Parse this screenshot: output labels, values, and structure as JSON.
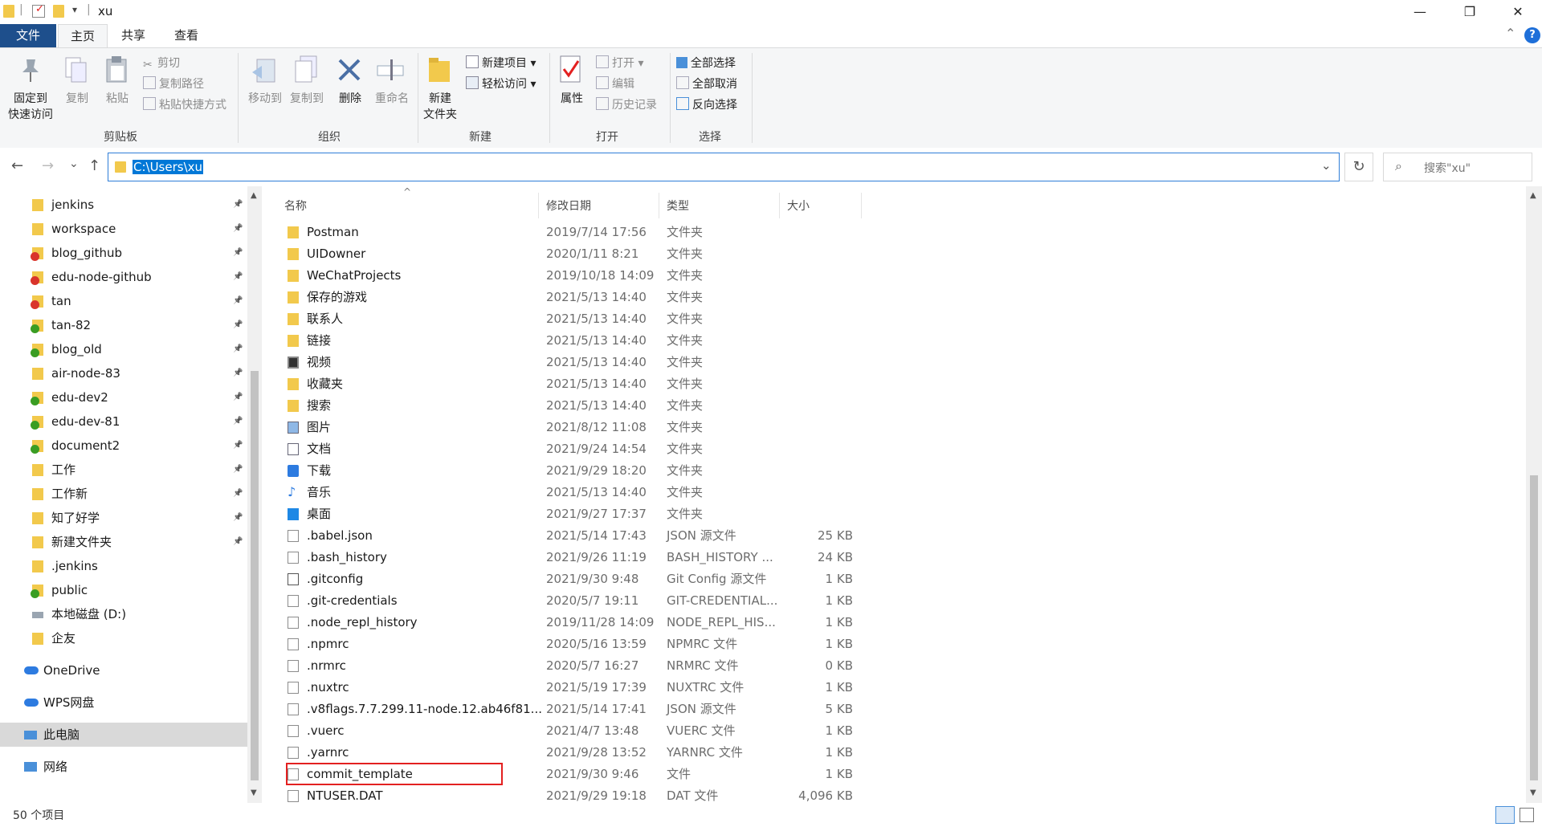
{
  "window": {
    "title": "xu",
    "controls": {
      "minimize": "—",
      "maximize": "❐",
      "close": "✕"
    },
    "quick_access_dropdown": "▾",
    "divider": "|"
  },
  "ribbon_tabs": [
    "文件",
    "主页",
    "共享",
    "查看"
  ],
  "ribbon_right": {
    "collapse": "⌃",
    "help": "?"
  },
  "ribbon": {
    "clipboard": {
      "pin_label_1": "固定到",
      "pin_label_2": "快速访问",
      "copy": "复制",
      "paste": "粘贴",
      "cut": "剪切",
      "copy_path": "复制路径",
      "paste_shortcut": "粘贴快捷方式",
      "group": "剪贴板"
    },
    "organize": {
      "move_to": "移动到",
      "copy_to": "复制到",
      "delete": "删除",
      "rename": "重命名",
      "group": "组织"
    },
    "new": {
      "new_folder_1": "新建",
      "new_folder_2": "文件夹",
      "new_item": "新建项目 ▾",
      "easy_access": "轻松访问 ▾",
      "group": "新建"
    },
    "open": {
      "properties": "属性",
      "open": "打开 ▾",
      "edit": "编辑",
      "history": "历史记录",
      "group": "打开"
    },
    "select": {
      "select_all": "全部选择",
      "select_none": "全部取消",
      "invert": "反向选择",
      "group": "选择"
    }
  },
  "address_bar": {
    "back": "←",
    "forward": "→",
    "recent": "⌄",
    "up": "↑",
    "path": "C:\\Users\\xu",
    "dropdown": "⌄",
    "refresh": "↻",
    "search_placeholder": "搜索\"xu\"",
    "search_icon": "⌕"
  },
  "nav_pane": {
    "quick_access": [
      {
        "label": "jenkins",
        "icon": "folder",
        "pinned": true
      },
      {
        "label": "workspace",
        "icon": "folder",
        "pinned": true
      },
      {
        "label": "blog_github",
        "icon": "git-conflict",
        "pinned": true
      },
      {
        "label": "edu-node-github",
        "icon": "git-conflict",
        "pinned": true
      },
      {
        "label": "tan",
        "icon": "git-conflict",
        "pinned": true
      },
      {
        "label": "tan-82",
        "icon": "git-ok",
        "pinned": true
      },
      {
        "label": "blog_old",
        "icon": "git-ok",
        "pinned": true
      },
      {
        "label": "air-node-83",
        "icon": "folder",
        "pinned": true
      },
      {
        "label": "edu-dev2",
        "icon": "git-ok",
        "pinned": true
      },
      {
        "label": "edu-dev-81",
        "icon": "git-ok",
        "pinned": true
      },
      {
        "label": "document2",
        "icon": "git-ok",
        "pinned": true
      },
      {
        "label": "工作",
        "icon": "folder",
        "pinned": true
      },
      {
        "label": "工作新",
        "icon": "folder",
        "pinned": true
      },
      {
        "label": "知了好学",
        "icon": "folder",
        "pinned": true
      },
      {
        "label": "新建文件夹",
        "icon": "folder",
        "pinned": true
      },
      {
        "label": ".jenkins",
        "icon": "folder",
        "pinned": false
      },
      {
        "label": "public",
        "icon": "git-ok",
        "pinned": false
      },
      {
        "label": "本地磁盘 (D:)",
        "icon": "drive",
        "pinned": false
      },
      {
        "label": "企友",
        "icon": "folder",
        "pinned": false
      }
    ],
    "locations": [
      {
        "label": "OneDrive",
        "icon": "cloud"
      },
      {
        "label": "WPS网盘",
        "icon": "cloud"
      },
      {
        "label": "此电脑",
        "icon": "computer",
        "selected": true
      },
      {
        "label": "网络",
        "icon": "network"
      }
    ]
  },
  "columns": {
    "name": "名称",
    "modified": "修改日期",
    "type": "类型",
    "size": "大小"
  },
  "sort_indicator": "^",
  "files": [
    {
      "name": "Postman",
      "date": "2019/7/14 17:56",
      "type": "文件夹",
      "size": "",
      "icon": "folder"
    },
    {
      "name": "UIDowner",
      "date": "2020/1/11 8:21",
      "type": "文件夹",
      "size": "",
      "icon": "folder"
    },
    {
      "name": "WeChatProjects",
      "date": "2019/10/18 14:09",
      "type": "文件夹",
      "size": "",
      "icon": "folder"
    },
    {
      "name": "保存的游戏",
      "date": "2021/5/13 14:40",
      "type": "文件夹",
      "size": "",
      "icon": "folder"
    },
    {
      "name": "联系人",
      "date": "2021/5/13 14:40",
      "type": "文件夹",
      "size": "",
      "icon": "folder"
    },
    {
      "name": "链接",
      "date": "2021/5/13 14:40",
      "type": "文件夹",
      "size": "",
      "icon": "folder"
    },
    {
      "name": "视频",
      "date": "2021/5/13 14:40",
      "type": "文件夹",
      "size": "",
      "icon": "video"
    },
    {
      "name": "收藏夹",
      "date": "2021/5/13 14:40",
      "type": "文件夹",
      "size": "",
      "icon": "folder"
    },
    {
      "name": "搜索",
      "date": "2021/5/13 14:40",
      "type": "文件夹",
      "size": "",
      "icon": "folder"
    },
    {
      "name": "图片",
      "date": "2021/8/12 11:08",
      "type": "文件夹",
      "size": "",
      "icon": "pictures"
    },
    {
      "name": "文档",
      "date": "2021/9/24 14:54",
      "type": "文件夹",
      "size": "",
      "icon": "documents"
    },
    {
      "name": "下载",
      "date": "2021/9/29 18:20",
      "type": "文件夹",
      "size": "",
      "icon": "download"
    },
    {
      "name": "音乐",
      "date": "2021/5/13 14:40",
      "type": "文件夹",
      "size": "",
      "icon": "music"
    },
    {
      "name": "桌面",
      "date": "2021/9/27 17:37",
      "type": "文件夹",
      "size": "",
      "icon": "desktop"
    },
    {
      "name": ".babel.json",
      "date": "2021/5/14 17:43",
      "type": "JSON 源文件",
      "size": "25 KB",
      "icon": "json"
    },
    {
      "name": ".bash_history",
      "date": "2021/9/26 11:19",
      "type": "BASH_HISTORY ...",
      "size": "24 KB",
      "icon": "file"
    },
    {
      "name": ".gitconfig",
      "date": "2021/9/30 9:48",
      "type": "Git Config 源文件",
      "size": "1 KB",
      "icon": "gear-file"
    },
    {
      "name": ".git-credentials",
      "date": "2020/5/7 19:11",
      "type": "GIT-CREDENTIAL...",
      "size": "1 KB",
      "icon": "file"
    },
    {
      "name": ".node_repl_history",
      "date": "2019/11/28 14:09",
      "type": "NODE_REPL_HIS...",
      "size": "1 KB",
      "icon": "file"
    },
    {
      "name": ".npmrc",
      "date": "2020/5/16 13:59",
      "type": "NPMRC 文件",
      "size": "1 KB",
      "icon": "file"
    },
    {
      "name": ".nrmrc",
      "date": "2020/5/7 16:27",
      "type": "NRMRC 文件",
      "size": "0 KB",
      "icon": "file"
    },
    {
      "name": ".nuxtrc",
      "date": "2021/5/19 17:39",
      "type": "NUXTRC 文件",
      "size": "1 KB",
      "icon": "file"
    },
    {
      "name": ".v8flags.7.7.299.11-node.12.ab46f81...",
      "date": "2021/5/14 17:41",
      "type": "JSON 源文件",
      "size": "5 KB",
      "icon": "json"
    },
    {
      "name": ".vuerc",
      "date": "2021/4/7 13:48",
      "type": "VUERC 文件",
      "size": "1 KB",
      "icon": "file"
    },
    {
      "name": ".yarnrc",
      "date": "2021/9/28 13:52",
      "type": "YARNRC 文件",
      "size": "1 KB",
      "icon": "file"
    },
    {
      "name": "commit_template",
      "date": "2021/9/30 9:46",
      "type": "文件",
      "size": "1 KB",
      "icon": "file",
      "highlighted": true
    },
    {
      "name": "NTUSER.DAT",
      "date": "2021/9/29 19:18",
      "type": "DAT 文件",
      "size": "4,096 KB",
      "icon": "file"
    }
  ],
  "status": {
    "count": "50 个项目"
  },
  "colors": {
    "accent": "#0078d7",
    "file_tab": "#1e4f8c",
    "highlight_box": "#e32020",
    "folder": "#f2c94c"
  }
}
